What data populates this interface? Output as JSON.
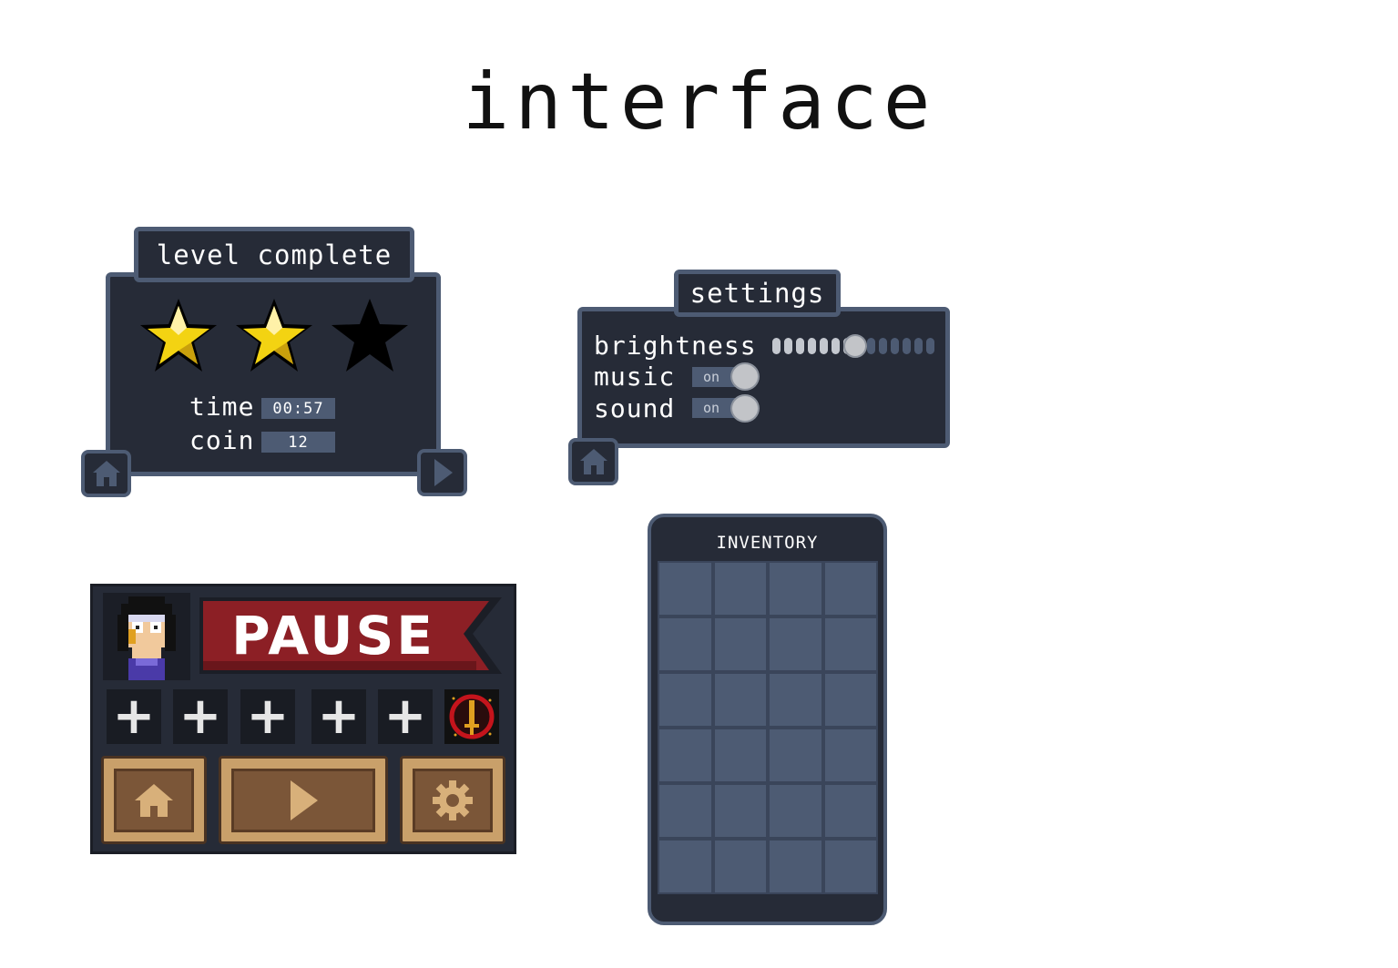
{
  "page": {
    "title": "interface"
  },
  "level_complete": {
    "title": "level complete",
    "stars_earned": 2,
    "stars_total": 3,
    "time_label": "time",
    "time_value": "00:57",
    "coin_label": "coin",
    "coin_value": "12",
    "home_icon": "home-icon",
    "next_icon": "play-arrow-icon"
  },
  "settings": {
    "title": "settings",
    "brightness_label": "brightness",
    "brightness_level": 7,
    "brightness_steps": 14,
    "music_label": "music",
    "music_state": "on",
    "sound_label": "sound",
    "sound_state": "on",
    "home_icon": "home-icon"
  },
  "pause": {
    "title": "PAUSE",
    "avatar_icon": "character-avatar",
    "slots": [
      "+",
      "+",
      "+",
      "+",
      "+"
    ],
    "special_item_icon": "sword-emblem-icon",
    "buttons": [
      "home-icon",
      "play-arrow-icon",
      "gear-icon"
    ]
  },
  "inventory": {
    "title": "INVENTORY",
    "rows": 6,
    "cols": 4
  },
  "colors": {
    "panel_bg": "#262b37",
    "panel_border": "#4d5b73",
    "star_gold": "#f3d312",
    "banner_red": "#8c1f25",
    "wood": "#c9a06a"
  }
}
